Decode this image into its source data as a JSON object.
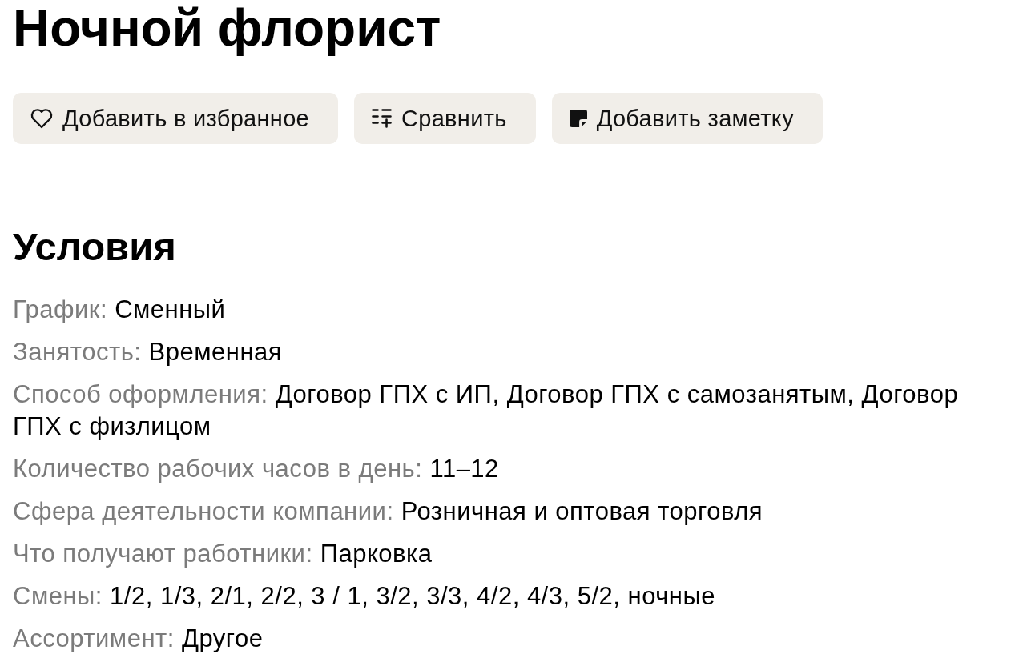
{
  "title": "Ночной флорист",
  "actions": [
    {
      "kind": "favorite",
      "label": "Добавить в избранное"
    },
    {
      "kind": "compare",
      "label": "Сравнить"
    },
    {
      "kind": "note",
      "label": "Добавить заметку"
    }
  ],
  "conditions": {
    "heading": "Условия",
    "rows": [
      {
        "label": "График:",
        "value": "Сменный"
      },
      {
        "label": "Занятость:",
        "value": "Временная"
      },
      {
        "label": "Способ оформления:",
        "value": "Договор ГПХ с ИП, Договор ГПХ с самозанятым, Договор ГПХ с физлицом"
      },
      {
        "label": "Количество рабочих часов в день:",
        "value": "11–12"
      },
      {
        "label": "Сфера деятельности компании:",
        "value": "Розничная и оптовая торговля"
      },
      {
        "label": "Что получают работники:",
        "value": "Парковка"
      },
      {
        "label": "Смены:",
        "value": "1/2, 1/3, 2/1, 2/2, 3 / 1, 3/2, 3/3, 4/2, 4/3, 5/2, ночные"
      },
      {
        "label": "Ассортимент:",
        "value": "Другое"
      }
    ]
  }
}
